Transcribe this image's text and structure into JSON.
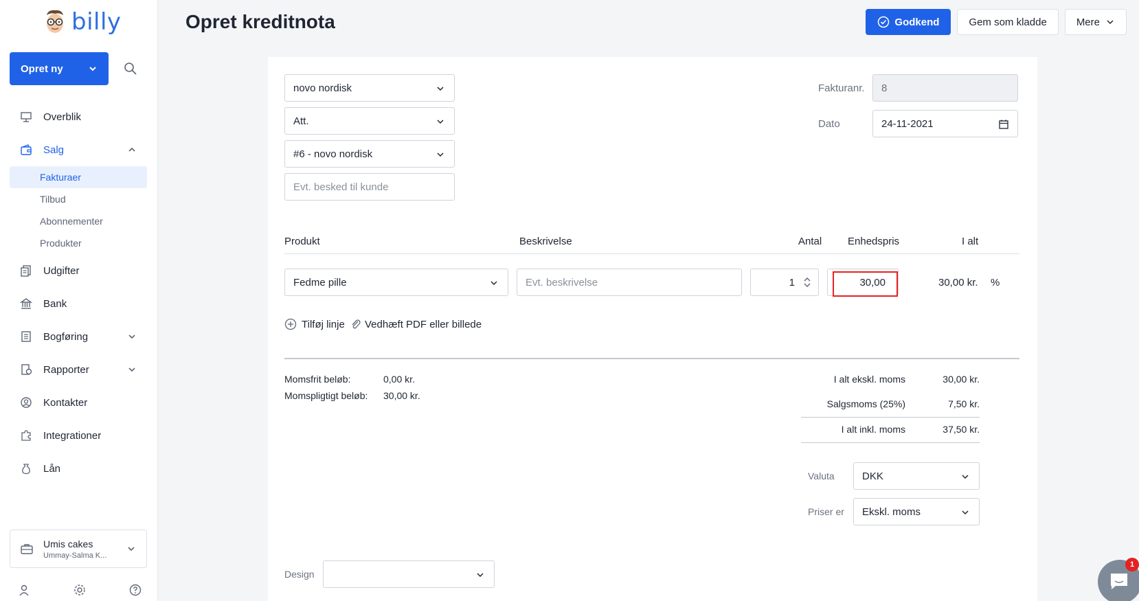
{
  "logo": {
    "text": "billy"
  },
  "sidebar": {
    "create_label": "Opret ny",
    "items": [
      {
        "label": "Overblik",
        "icon": "monitor-icon"
      },
      {
        "label": "Salg",
        "icon": "wallet-icon"
      },
      {
        "label": "Udgifter",
        "icon": "receipt-icon"
      },
      {
        "label": "Bank",
        "icon": "bank-icon"
      },
      {
        "label": "Bogføring",
        "icon": "ledger-icon"
      },
      {
        "label": "Rapporter",
        "icon": "report-icon"
      },
      {
        "label": "Kontakter",
        "icon": "contact-icon"
      },
      {
        "label": "Integrationer",
        "icon": "puzzle-icon"
      },
      {
        "label": "Lån",
        "icon": "money-bag-icon"
      }
    ],
    "sales_sub": [
      "Fakturaer",
      "Tilbud",
      "Abonnementer",
      "Produkter"
    ],
    "org": {
      "name": "Umis cakes",
      "sub": "Ummay-Salma K..."
    }
  },
  "header": {
    "title": "Opret kreditnota",
    "approve_label": "Godkend",
    "draft_label": "Gem som kladde",
    "more_label": "Mere"
  },
  "form": {
    "customer": "novo nordisk",
    "att": "Att.",
    "contact": "#6 - novo nordisk",
    "message_placeholder": "Evt. besked til kunde",
    "invoice_no_label": "Fakturanr.",
    "invoice_no": "8",
    "date_label": "Dato",
    "date": "24-11-2021"
  },
  "lines": {
    "headers": {
      "product": "Produkt",
      "description": "Beskrivelse",
      "qty": "Antal",
      "unit_price": "Enhedspris",
      "total": "I alt"
    },
    "row": {
      "product": "Fedme pille",
      "description_placeholder": "Evt. beskrivelse",
      "qty": "1",
      "unit_price": "30,00",
      "total": "30,00 kr.",
      "percent": "%"
    },
    "add_line": "Tilføj linje",
    "attach": "Vedhæft PDF eller billede"
  },
  "summary": {
    "vat_free_label": "Momsfrit beløb:",
    "vat_free": "0,00 kr.",
    "vat_liable_label": "Momspligtigt beløb:",
    "vat_liable": "30,00 kr.",
    "excl_label": "I alt ekskl. moms",
    "excl": "30,00 kr.",
    "vat_label": "Salgsmoms (25%)",
    "vat": "7,50 kr.",
    "incl_label": "I alt inkl. moms",
    "incl": "37,50 kr.",
    "currency_label": "Valuta",
    "currency": "DKK",
    "prices_label": "Priser er",
    "prices": "Ekskl. moms",
    "design_label": "Design"
  },
  "chat": {
    "badge": "1"
  },
  "colors": {
    "accent": "#1f62e8",
    "highlight": "#e52222"
  }
}
